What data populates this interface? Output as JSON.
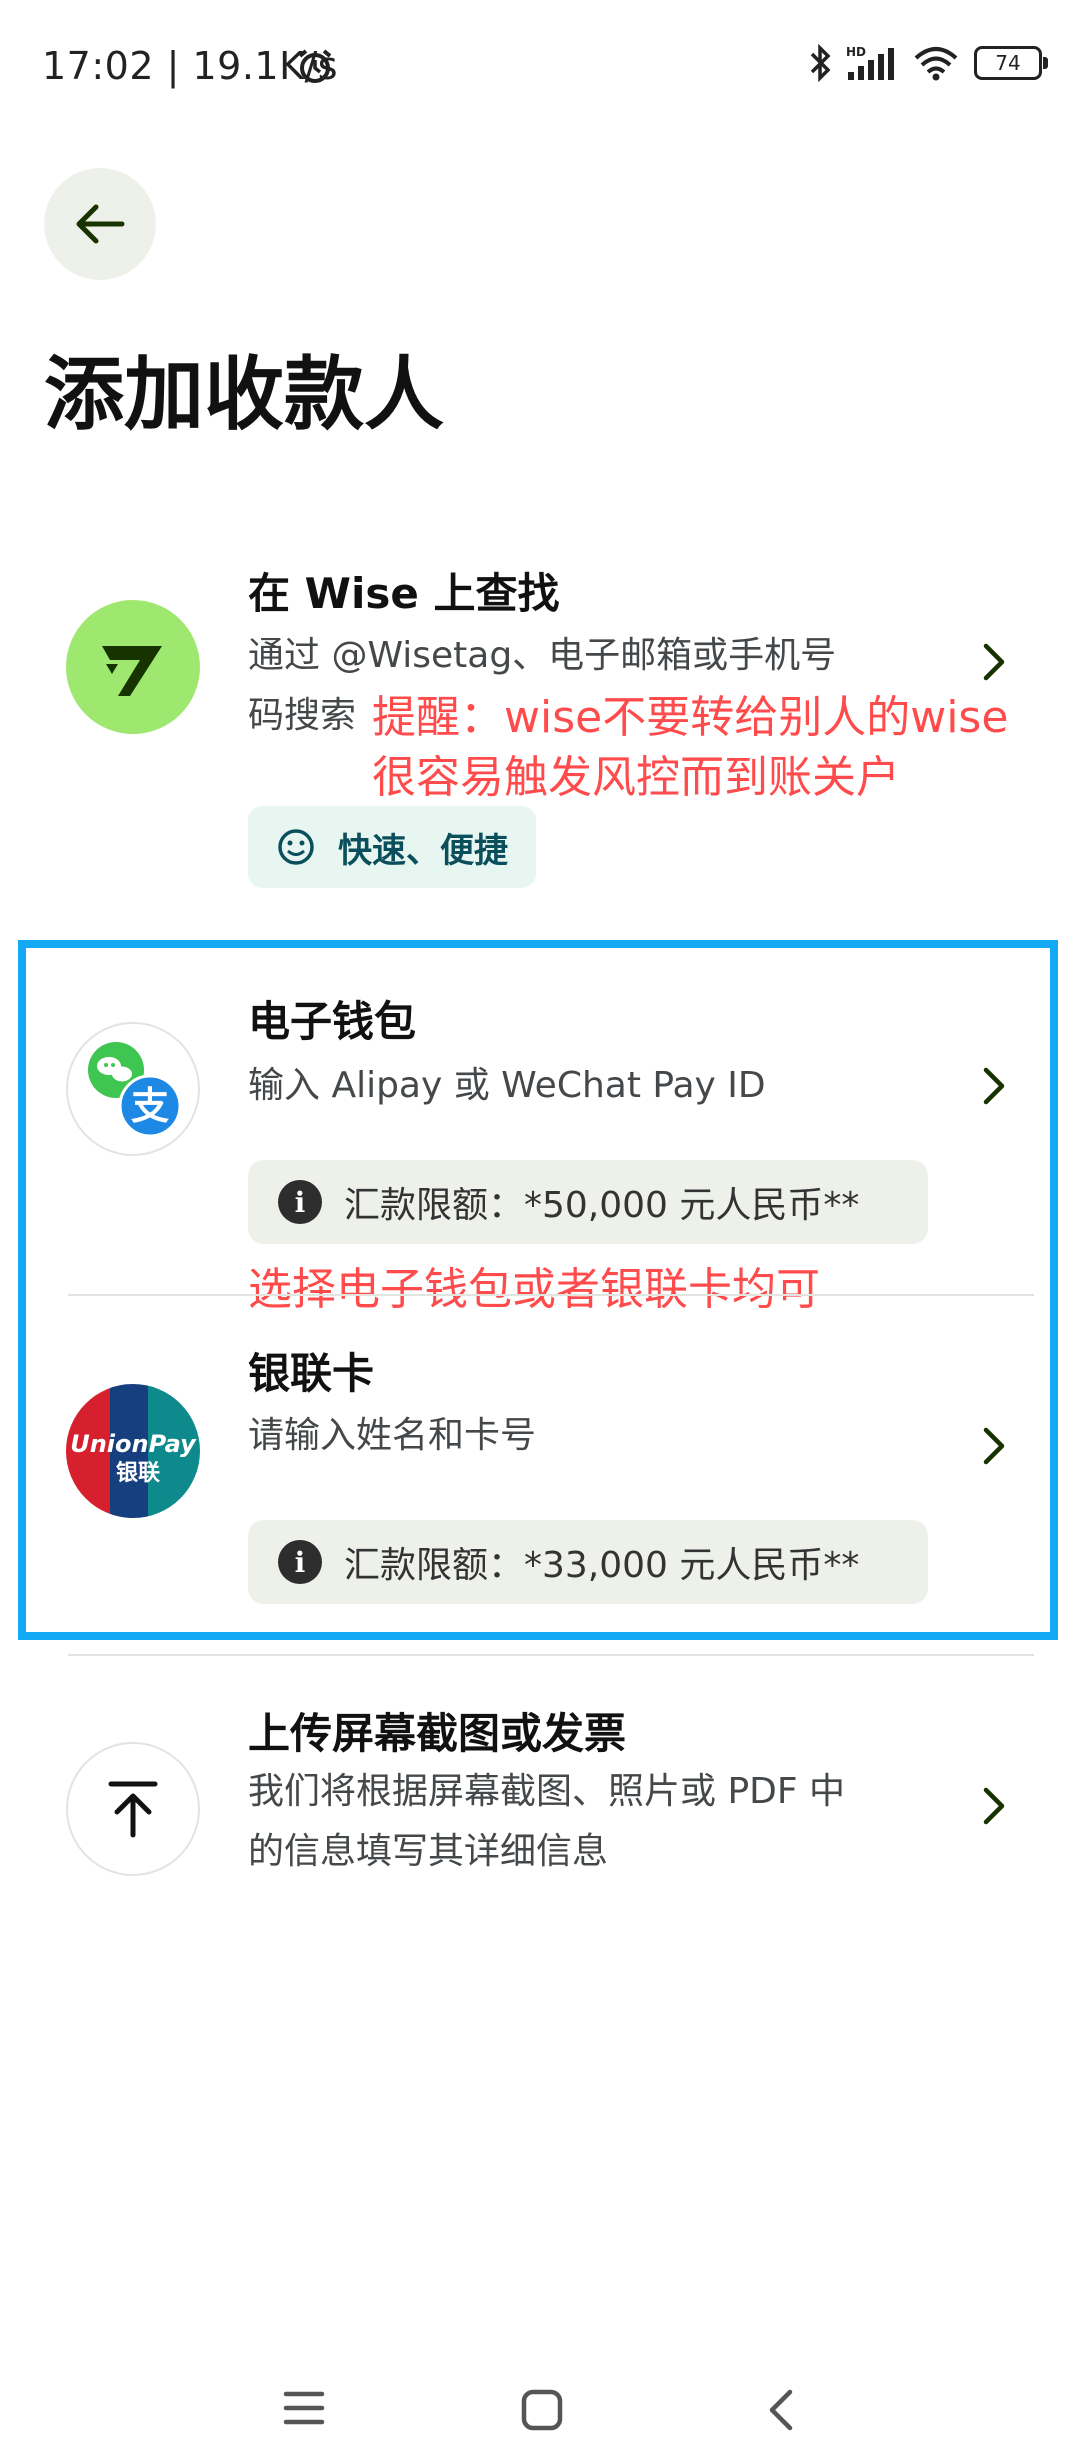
{
  "status": {
    "time": "17:02 | 19.1K/s",
    "battery": "74"
  },
  "header": {
    "title": "添加收款人"
  },
  "wise_option": {
    "title": "在 Wise 上查找",
    "desc_line1": "通过 @Wisetag、电子邮箱或手机号",
    "desc_line2": "码搜索",
    "tag": "快速、便捷"
  },
  "annotations": {
    "warning_line1": "提醒：wise不要转给别人的wise",
    "warning_line2": "很容易触发风控而到账关户",
    "choose": "选择电子钱包或者银联卡均可"
  },
  "ewallet_option": {
    "title": "电子钱包",
    "desc": "输入 Alipay 或 WeChat Pay ID",
    "limit": "汇款限额：*50,000 元人民币**"
  },
  "unionpay_option": {
    "title": "银联卡",
    "desc": "请输入姓名和卡号",
    "limit": "汇款限额：*33,000 元人民币**",
    "logo_text_en": "UnionPay",
    "logo_text_cn": "银联"
  },
  "upload_option": {
    "title": "上传屏幕截图或发票",
    "desc_line1": "我们将根据屏幕截图、照片或 PDF 中",
    "desc_line2": "的信息填写其详细信息"
  },
  "colors": {
    "brand_green": "#9fe870",
    "brand_dark": "#163300",
    "annotation_red": "#ff4b4b",
    "highlight_blue": "#14a9f5"
  },
  "icons": [
    "back-arrow-icon",
    "wise-logo-icon",
    "smile-icon",
    "wechat-icon",
    "alipay-icon",
    "info-icon",
    "chevron-right-icon",
    "upload-icon",
    "menu-icon",
    "home-icon",
    "back-nav-icon"
  ]
}
